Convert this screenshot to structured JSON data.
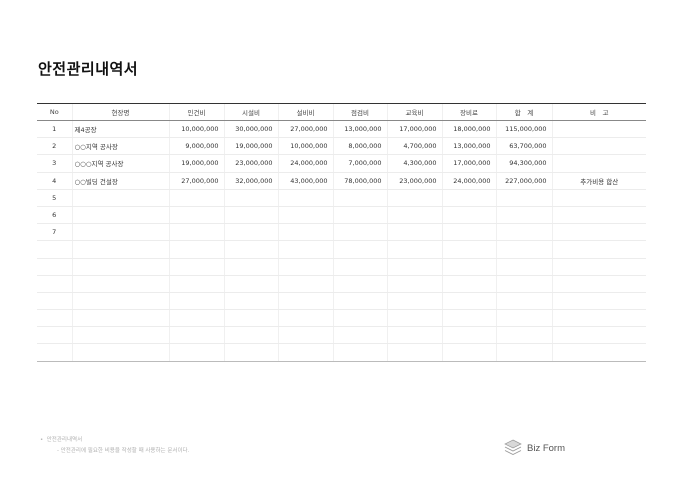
{
  "document": {
    "title": "안전관리내역서"
  },
  "table": {
    "headers": [
      "No",
      "현장명",
      "인건비",
      "시설비",
      "설비비",
      "점검비",
      "교육비",
      "장비료",
      "합　계",
      "비　고"
    ],
    "rows": [
      [
        "1",
        "제4공장",
        "10,000,000",
        "30,000,000",
        "27,000,000",
        "13,000,000",
        "17,000,000",
        "18,000,000",
        "115,000,000",
        ""
      ],
      [
        "2",
        "○○지역 공사장",
        "9,000,000",
        "19,000,000",
        "10,000,000",
        "8,000,000",
        "4,700,000",
        "13,000,000",
        "63,700,000",
        ""
      ],
      [
        "3",
        "○○○지역 공사장",
        "19,000,000",
        "23,000,000",
        "24,000,000",
        "7,000,000",
        "4,300,000",
        "17,000,000",
        "94,300,000",
        ""
      ],
      [
        "4",
        "○○빌딩 건설장",
        "27,000,000",
        "32,000,000",
        "43,000,000",
        "78,000,000",
        "23,000,000",
        "24,000,000",
        "227,000,000",
        "추가비용 합산"
      ],
      [
        "5",
        "",
        "",
        "",
        "",
        "",
        "",
        "",
        "",
        ""
      ],
      [
        "6",
        "",
        "",
        "",
        "",
        "",
        "",
        "",
        "",
        ""
      ],
      [
        "7",
        "",
        "",
        "",
        "",
        "",
        "",
        "",
        "",
        ""
      ],
      [
        "",
        "",
        "",
        "",
        "",
        "",
        "",
        "",
        "",
        ""
      ],
      [
        "",
        "",
        "",
        "",
        "",
        "",
        "",
        "",
        "",
        ""
      ],
      [
        "",
        "",
        "",
        "",
        "",
        "",
        "",
        "",
        "",
        ""
      ],
      [
        "",
        "",
        "",
        "",
        "",
        "",
        "",
        "",
        "",
        ""
      ],
      [
        "",
        "",
        "",
        "",
        "",
        "",
        "",
        "",
        "",
        ""
      ],
      [
        "",
        "",
        "",
        "",
        "",
        "",
        "",
        "",
        "",
        ""
      ],
      [
        "",
        "",
        "",
        "",
        "",
        "",
        "",
        "",
        "",
        ""
      ]
    ]
  },
  "footer": {
    "bullet": "•",
    "note_title": "안전관리내역서",
    "note_desc": "- 안전관리에 필요한 비용을 작성할 때 사용하는 문서이다."
  },
  "brand": {
    "name": "Biz Form",
    "icon": "biz-form-logo-icon",
    "color": "#555555"
  }
}
